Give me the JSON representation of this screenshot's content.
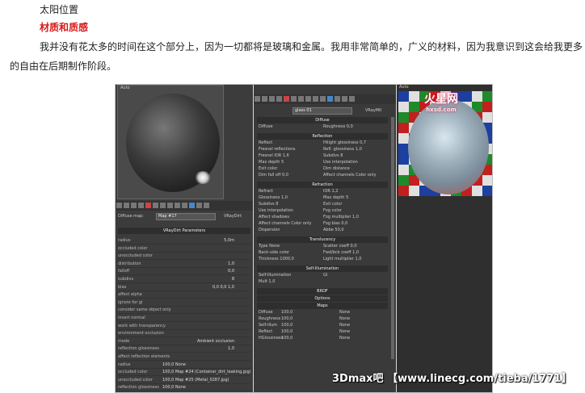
{
  "text": {
    "line1": "太阳位置",
    "heading": "材质和质感",
    "line3": "我并没有花太多的时间在这个部分上，因为一切都将是玻璃和金属。我用非常简单的，广义的材料，因为我意识到这会给我更多",
    "line4": "的自由在后期制作阶段。"
  },
  "screenshot": {
    "left_panel": {
      "top_label": "Auto",
      "diffuse_map_label": "Diffuse map:",
      "map_name": "Map #17",
      "map_type": "VRayDirt",
      "params_title": "VRayDirt Parameters",
      "rows": [
        {
          "label": "radius",
          "value": "5,0m"
        },
        {
          "label": "occluded color",
          "value": ""
        },
        {
          "label": "unoccluded color",
          "value": ""
        },
        {
          "label": "distribution",
          "value": "1,0"
        },
        {
          "label": "falloff",
          "value": "0,0"
        },
        {
          "label": "subdivs",
          "value": "8"
        },
        {
          "label": "bias",
          "value": "0,0   0,0   1,0"
        },
        {
          "label": "affect alpha",
          "value": ""
        },
        {
          "label": "ignore for gi",
          "value": ""
        },
        {
          "label": "consider same object only",
          "value": ""
        },
        {
          "label": "invert normal",
          "value": ""
        },
        {
          "label": "work with transparency",
          "value": ""
        },
        {
          "label": "environment occlusion",
          "value": ""
        },
        {
          "label": "mode",
          "value": "Ambient occlusion"
        },
        {
          "label": "reflection glossiness",
          "value": "1,0"
        },
        {
          "label": "affect reflection elements",
          "value": ""
        },
        {
          "label": "radius",
          "value": "100,0  None"
        },
        {
          "label": "occluded color",
          "value": "100,0  Map #24 (Container_dirt_leaking.jpg)"
        },
        {
          "label": "unoccluded color",
          "value": "100,0  Map #25 (Metal_0287.jpg)"
        },
        {
          "label": "reflection glossiness",
          "value": "100,0  None"
        }
      ]
    },
    "mid_panel": {
      "material_name": "glass 01",
      "material_type": "VRayMtl",
      "sections": {
        "diffuse": "Diffuse",
        "reflection": "Reflection",
        "refraction": "Refraction",
        "translucency": "Translucency",
        "self_illumination": "Self-Illumination",
        "brdf": "BRDF",
        "options": "Options",
        "maps": "Maps"
      },
      "diffuse_rows": [
        {
          "label": "Diffuse",
          "value": ""
        },
        {
          "label": "Roughness",
          "value": "0,0"
        }
      ],
      "reflection_rows": [
        {
          "label": "Reflect",
          "value": ""
        },
        {
          "label": "Hilight glossiness",
          "value": "0,7"
        },
        {
          "label": "Fresnel reflections",
          "value": ""
        },
        {
          "label": "Refl. glossiness",
          "value": "1,0"
        },
        {
          "label": "Fresnel IOR",
          "value": "1,6"
        },
        {
          "label": "Subdivs",
          "value": "8"
        },
        {
          "label": "Max depth",
          "value": "5"
        },
        {
          "label": "Use interpolation",
          "value": ""
        },
        {
          "label": "Exit color",
          "value": ""
        },
        {
          "label": "Dim distance",
          "value": ""
        },
        {
          "label": "Dim fall off",
          "value": "0,0"
        },
        {
          "label": "Affect channels",
          "value": "Color only"
        }
      ],
      "refraction_rows": [
        {
          "label": "Refract",
          "value": ""
        },
        {
          "label": "IOR",
          "value": "1,2"
        },
        {
          "label": "Glossiness",
          "value": "1,0"
        },
        {
          "label": "Max depth",
          "value": "5"
        },
        {
          "label": "Subdivs",
          "value": "8"
        },
        {
          "label": "Exit color",
          "value": ""
        },
        {
          "label": "Use interpolation",
          "value": ""
        },
        {
          "label": "Fog color",
          "value": ""
        },
        {
          "label": "Affect shadows",
          "value": ""
        },
        {
          "label": "Fog multiplier",
          "value": "1,0"
        },
        {
          "label": "Affect channels",
          "value": "Color only"
        },
        {
          "label": "Fog bias",
          "value": "0,0"
        },
        {
          "label": "Dispersion",
          "value": ""
        },
        {
          "label": "Abbe",
          "value": "50,0"
        }
      ],
      "translucency_rows": [
        {
          "label": "Type",
          "value": "None"
        },
        {
          "label": "Scatter coeff",
          "value": "0,0"
        },
        {
          "label": "Back-side color",
          "value": ""
        },
        {
          "label": "Fwd/bck coeff",
          "value": "1,0"
        },
        {
          "label": "Thickness",
          "value": "1000,0"
        },
        {
          "label": "Light multiplier",
          "value": "1,0"
        }
      ],
      "self_illum_rows": [
        {
          "label": "Self-Illumination",
          "value": ""
        },
        {
          "label": "GI",
          "value": ""
        },
        {
          "label": "Mult",
          "value": "1,0"
        }
      ],
      "map_rows": [
        {
          "label": "Diffuse",
          "amount": "100,0",
          "map": "None"
        },
        {
          "label": "Roughness",
          "amount": "100,0",
          "map": "None"
        },
        {
          "label": "Self-illum",
          "amount": "100,0",
          "map": "None"
        },
        {
          "label": "Reflect",
          "amount": "100,0",
          "map": "None"
        },
        {
          "label": "HGlossiness",
          "amount": "100,0",
          "map": "None"
        }
      ]
    },
    "right_panel": {
      "top_label": "Auto",
      "logo": "火星网",
      "logo_sub": "hxsd.com"
    }
  },
  "watermark": "3Dmax吧 【www.linecg.com/tieba/1771】",
  "colors": {
    "heading": "#d61a1a",
    "diffuse_swatch": "#a9d4ee"
  }
}
